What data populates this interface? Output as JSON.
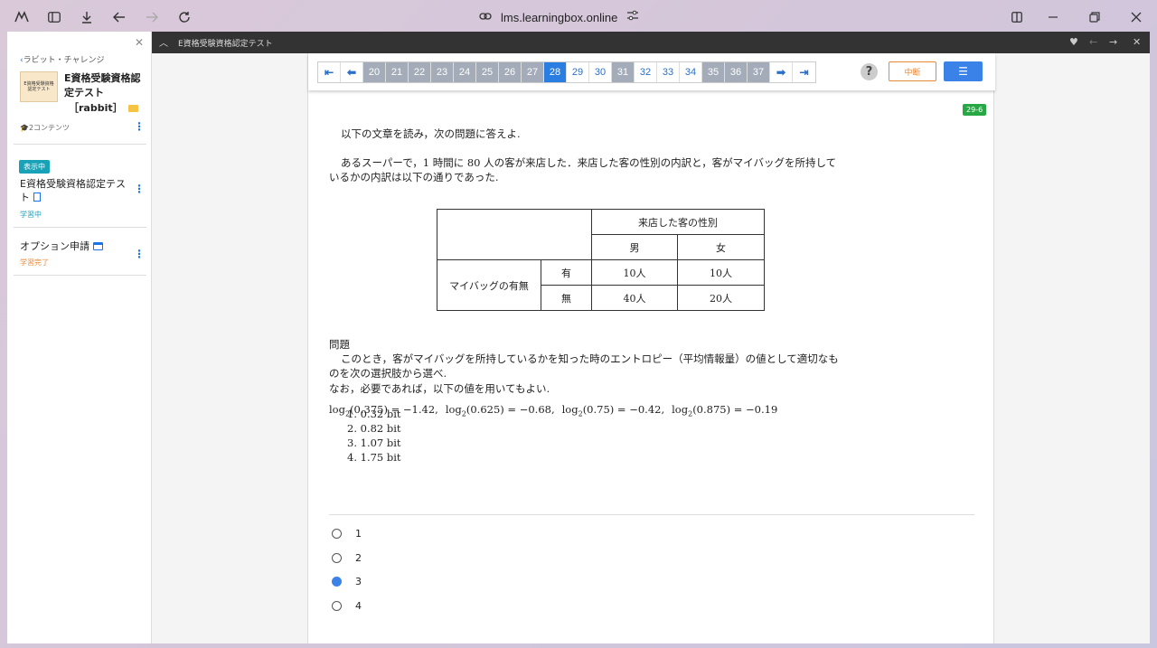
{
  "browser": {
    "url": "lms.learningbox.online"
  },
  "topbar": {
    "title": "E資格受験資格認定テスト"
  },
  "sidebar": {
    "back_label": "ラビット・チャレンジ",
    "thumb_lines": [
      "E資格受験資格",
      "認定テスト"
    ],
    "course_title": "E資格受験資格認定テスト",
    "course_sub": "［rabbit］",
    "content_count": "2コンテンツ",
    "current_badge": "表示中",
    "items": [
      {
        "title": "E資格受験資格認定テスト",
        "status": "学習中",
        "status_color": "#17a2b8"
      },
      {
        "title": "オプション申請",
        "status": "学習完了",
        "status_color": "#e8893a"
      }
    ]
  },
  "pager": {
    "pages": [
      {
        "label": "20",
        "state": "done"
      },
      {
        "label": "21",
        "state": "done"
      },
      {
        "label": "22",
        "state": "done"
      },
      {
        "label": "23",
        "state": "done"
      },
      {
        "label": "24",
        "state": "done"
      },
      {
        "label": "25",
        "state": "done"
      },
      {
        "label": "26",
        "state": "done"
      },
      {
        "label": "27",
        "state": "done"
      },
      {
        "label": "28",
        "state": "current"
      },
      {
        "label": "29",
        "state": "todo"
      },
      {
        "label": "30",
        "state": "todo"
      },
      {
        "label": "31",
        "state": "done"
      },
      {
        "label": "32",
        "state": "todo"
      },
      {
        "label": "33",
        "state": "todo"
      },
      {
        "label": "34",
        "state": "todo"
      },
      {
        "label": "35",
        "state": "done"
      },
      {
        "label": "36",
        "state": "done"
      },
      {
        "label": "37",
        "state": "done"
      }
    ],
    "help_label": "?",
    "pause_label": "中断"
  },
  "question": {
    "id": "29-6",
    "intro": "以下の文章を読み，次の問題に答えよ.",
    "para1": "あるスーパーで，1 時間に 80 人の客が来店した．来店した客の性別の内訳と，客がマイバッグを所持して",
    "para2": "いるかの内訳は以下の通りであった.",
    "table": {
      "header": "来店した客の性別",
      "male": "男",
      "female": "女",
      "row_label": "マイバッグの有無",
      "yes": "有",
      "no": "無",
      "yes_male": "10人",
      "yes_female": "10人",
      "no_male": "40人",
      "no_female": "20人"
    },
    "problem_heading": "問題",
    "problem1": "このとき，客がマイバッグを所持しているかを知った時のエントロピー（平均情報量）の値として適切なも",
    "problem2": "のを次の選択肢から選べ.",
    "problem3": "なお，必要であれば，以下の値を用いてもよい.",
    "formula": [
      {
        "arg": "(0.375)",
        "val": "= −1.42,"
      },
      {
        "arg": "(0.625)",
        "val": "= −0.68,"
      },
      {
        "arg": "(0.75)",
        "val": "= −0.42,"
      },
      {
        "arg": "(0.875)",
        "val": "= −0.19"
      }
    ],
    "log_label": "log",
    "log_base": "2",
    "choices": [
      "1. 0.32 bit",
      "2. 0.82 bit",
      "3. 1.07 bit",
      "4. 1.75 bit"
    ]
  },
  "answers": [
    {
      "label": "1",
      "selected": false
    },
    {
      "label": "2",
      "selected": false
    },
    {
      "label": "3",
      "selected": true
    },
    {
      "label": "4",
      "selected": false
    }
  ],
  "colors": {
    "accent": "#2a7de1",
    "done": "#a3acb8",
    "selected_badge": "#17a2b8",
    "qid": "#28a745"
  }
}
